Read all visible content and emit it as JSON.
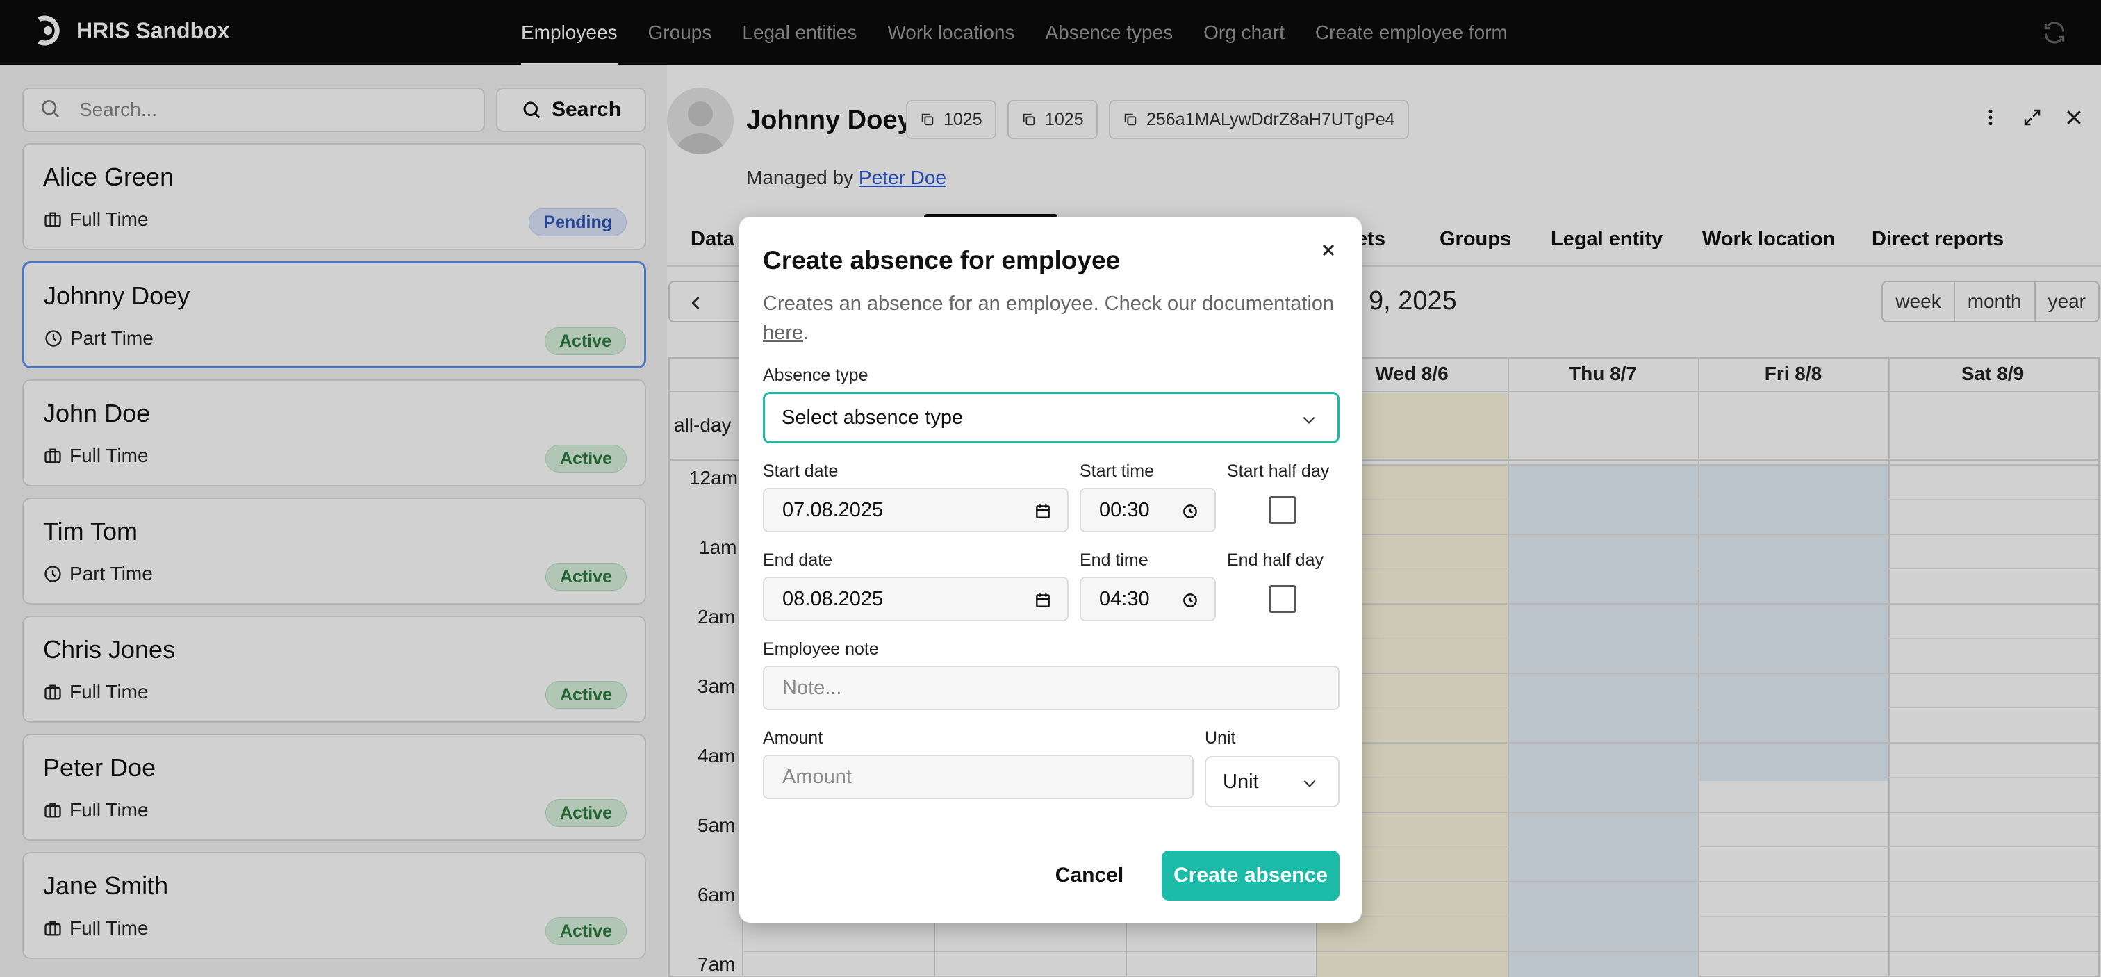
{
  "app": {
    "title": "HRIS Sandbox"
  },
  "nav": {
    "items": [
      {
        "label": "Employees",
        "active": true
      },
      {
        "label": "Groups"
      },
      {
        "label": "Legal entities"
      },
      {
        "label": "Work locations"
      },
      {
        "label": "Absence types"
      },
      {
        "label": "Org chart"
      },
      {
        "label": "Create employee form"
      }
    ]
  },
  "search": {
    "placeholder": "Search...",
    "button_label": "Search"
  },
  "employees": [
    {
      "name": "Alice Green",
      "type": "Full Time",
      "type_icon": "briefcase-icon",
      "status": "Pending"
    },
    {
      "name": "Johnny Doey",
      "type": "Part Time",
      "type_icon": "clock-icon",
      "status": "Active",
      "selected": true
    },
    {
      "name": "John Doe",
      "type": "Full Time",
      "type_icon": "briefcase-icon",
      "status": "Active"
    },
    {
      "name": "Tim Tom",
      "type": "Part Time",
      "type_icon": "clock-icon",
      "status": "Active"
    },
    {
      "name": "Chris Jones",
      "type": "Full Time",
      "type_icon": "briefcase-icon",
      "status": "Active"
    },
    {
      "name": "Peter Doe",
      "type": "Full Time",
      "type_icon": "briefcase-icon",
      "status": "Active"
    },
    {
      "name": "Jane Smith",
      "type": "Full Time",
      "type_icon": "briefcase-icon",
      "status": "Active"
    }
  ],
  "detail": {
    "name": "Johnny Doey",
    "chips": [
      "1025",
      "1025",
      "256a1MALywDdrZ8aH7UTgPe4"
    ],
    "managed_prefix": "Managed by",
    "manager": "Peter Doe",
    "tabs": [
      "Data",
      "eets",
      "Groups",
      "Legal entity",
      "Work location",
      "Direct reports"
    ],
    "calendar": {
      "date_fragment": "9, 2025",
      "views": [
        "week",
        "month",
        "year"
      ],
      "days": [
        "Wed 8/6",
        "Thu 8/7",
        "Fri 8/8",
        "Sat 8/9"
      ],
      "allday_label": "all-day",
      "hours": [
        "12am",
        "1am",
        "2am",
        "3am",
        "4am",
        "5am",
        "6am",
        "7am"
      ]
    }
  },
  "modal": {
    "title": "Create absence for employee",
    "description": "Creates an absence for an employee. Check our documentation",
    "doc_link": "here",
    "doc_suffix": ".",
    "absence_type_label": "Absence type",
    "absence_type_value": "Select absence type",
    "start_date_label": "Start date",
    "start_date_value": "07.08.2025",
    "start_time_label": "Start time",
    "start_time_value": "00:30",
    "start_half_label": "Start half day",
    "end_date_label": "End date",
    "end_date_value": "08.08.2025",
    "end_time_label": "End time",
    "end_time_value": "04:30",
    "end_half_label": "End half day",
    "note_label": "Employee note",
    "note_placeholder": "Note...",
    "amount_label": "Amount",
    "amount_placeholder": "Amount",
    "unit_label": "Unit",
    "unit_value": "Unit",
    "cancel_label": "Cancel",
    "submit_label": "Create absence"
  },
  "colors": {
    "accent": "#1bbba8",
    "active_badge": "#d9f2de",
    "pending_badge": "#dde6fb",
    "selected_border": "#5b8fe8"
  }
}
